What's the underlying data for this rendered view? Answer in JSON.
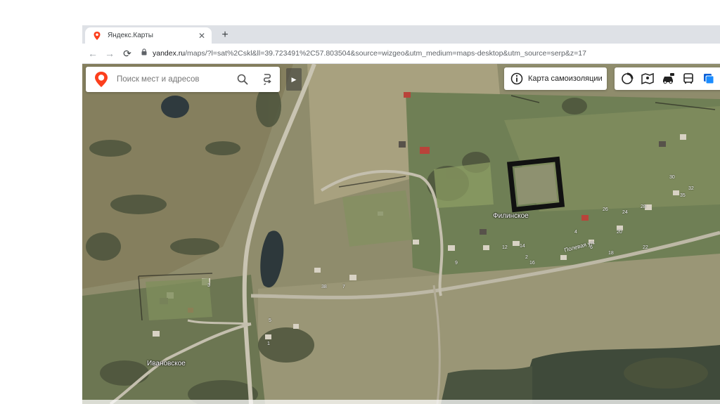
{
  "browser": {
    "tab": {
      "title": "Яндекс.Карты",
      "close": "✕"
    },
    "new_tab": "+",
    "nav": {
      "back": "←",
      "forward": "→",
      "reload": "⟳"
    },
    "url": {
      "host": "yandex.ru",
      "rest": "/maps/?l=sat%2Cskl&ll=39.723491%2C57.803504&source=wizgeo&utm_medium=maps-desktop&utm_source=serp&z=17"
    }
  },
  "map": {
    "search": {
      "placeholder": "Поиск мест и адресов"
    },
    "collapse": "▶",
    "self_isolation_button": "Карта самоизоляции",
    "labels": {
      "filinskoe": "Филинское",
      "ivanovskoe": "Ивановское",
      "street": "Полевая ул."
    },
    "house_numbers": [
      "3",
      "12",
      "14",
      "16",
      "18",
      "20",
      "22",
      "24",
      "26",
      "28",
      "30",
      "32",
      "35",
      "38",
      "9",
      "7",
      "5",
      "1",
      "2",
      "4",
      "6"
    ],
    "layer_icons": [
      "traffic-icon",
      "panorama-icon",
      "carsharing-icon",
      "transit-icon",
      "layers-icon"
    ],
    "colors": {
      "yandex_red": "#fc3f1d",
      "layer_blue": "#1a73e8"
    }
  }
}
